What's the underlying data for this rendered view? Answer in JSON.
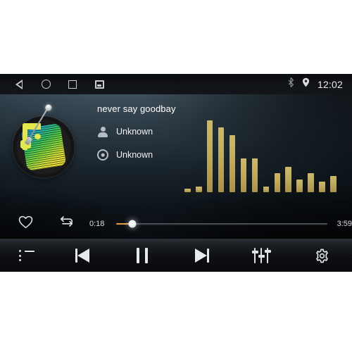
{
  "status_bar": {
    "nav": [
      {
        "name": "back",
        "label": "Back"
      },
      {
        "name": "home",
        "label": "Home"
      },
      {
        "name": "recents",
        "label": "Recent apps"
      },
      {
        "name": "screenshot",
        "label": "Screenshot"
      }
    ],
    "icons": [
      {
        "name": "bluetooth-icon",
        "label": "Bluetooth"
      },
      {
        "name": "location-icon",
        "label": "Location"
      }
    ],
    "clock": "12:02"
  },
  "now_playing": {
    "title": "never say goodbay",
    "artist": "Unknown",
    "album": "Unknown",
    "artist_icon": "person-icon",
    "album_icon": "disc-icon",
    "album_art": "vinyl-record-music-note"
  },
  "visualizer": {
    "label": "Audio spectrum visualizer",
    "bar_color": "#c0ab5d",
    "bars": [
      5,
      7,
      93,
      84,
      74,
      44,
      44,
      7,
      25,
      33,
      16,
      25,
      14,
      21
    ]
  },
  "transport": {
    "favorite_label": "Favorite",
    "favorite_icon": "heart-icon",
    "repeat_label": "Repeat",
    "repeat_icon": "repeat-icon",
    "time_current": "0:18",
    "time_total": "3:59",
    "progress_percent": 7.5,
    "accent_color": "#e8a038"
  },
  "controls": [
    {
      "name": "playlist",
      "label": "Playlist",
      "icon": "list-icon"
    },
    {
      "name": "previous",
      "label": "Previous",
      "icon": "previous-icon"
    },
    {
      "name": "pause",
      "label": "Pause",
      "icon": "pause-icon"
    },
    {
      "name": "next",
      "label": "Next",
      "icon": "next-icon"
    },
    {
      "name": "equalizer",
      "label": "Equalizer",
      "icon": "equalizer-icon"
    },
    {
      "name": "settings",
      "label": "Settings",
      "icon": "gear-icon"
    }
  ]
}
